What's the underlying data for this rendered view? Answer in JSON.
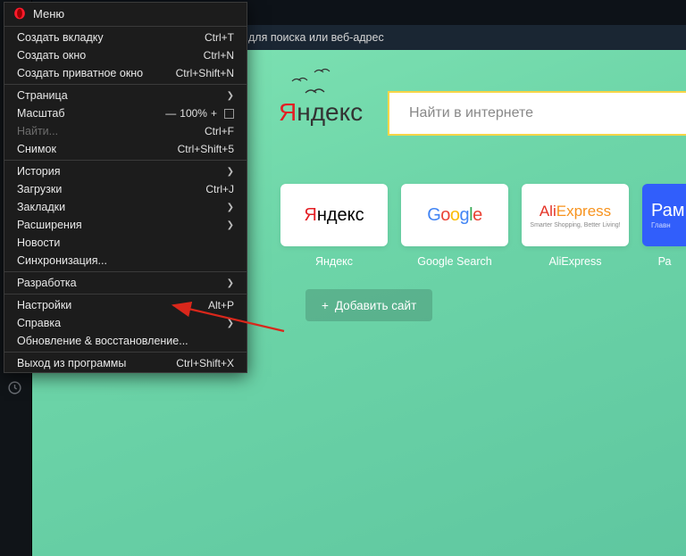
{
  "menu": {
    "header": "Меню",
    "items": [
      {
        "label": "Создать вкладку",
        "shortcut": "Ctrl+T"
      },
      {
        "label": "Создать окно",
        "shortcut": "Ctrl+N"
      },
      {
        "label": "Создать приватное окно",
        "shortcut": "Ctrl+Shift+N"
      }
    ],
    "group2": [
      {
        "label": "Страница",
        "submenu": true
      },
      {
        "label": "Масштаб",
        "zoom": true,
        "zoom_value": "100%"
      },
      {
        "label": "Найти...",
        "shortcut": "Ctrl+F",
        "disabled": true
      },
      {
        "label": "Снимок",
        "shortcut": "Ctrl+Shift+5"
      }
    ],
    "group3": [
      {
        "label": "История",
        "submenu": true
      },
      {
        "label": "Загрузки",
        "shortcut": "Ctrl+J"
      },
      {
        "label": "Закладки",
        "submenu": true
      },
      {
        "label": "Расширения",
        "submenu": true
      },
      {
        "label": "Новости"
      },
      {
        "label": "Синхронизация..."
      }
    ],
    "group4": [
      {
        "label": "Разработка",
        "submenu": true
      }
    ],
    "group5": [
      {
        "label": "Настройки",
        "shortcut": "Alt+P"
      },
      {
        "label": "Справка",
        "submenu": true
      },
      {
        "label": "Обновление & восстановление..."
      }
    ],
    "group6": [
      {
        "label": "Выход из программы",
        "shortcut": "Ctrl+Shift+X"
      }
    ]
  },
  "addressbar": {
    "placeholder": "для поиска или веб-адрес"
  },
  "logo": {
    "text": "Яндекс"
  },
  "search": {
    "placeholder": "Найти в интернете"
  },
  "tiles": [
    {
      "name": "yandex",
      "label": "Яндекс",
      "display": "Яндекс"
    },
    {
      "name": "google",
      "label": "Google Search",
      "display": "Google"
    },
    {
      "name": "aliexpress",
      "label": "AliExpress",
      "display": "AliExpress",
      "tagline": "Smarter Shopping, Better Living!"
    },
    {
      "name": "rambler",
      "label": "Ра",
      "display": "Рам",
      "tagline": "Главн"
    }
  ],
  "add_site": {
    "label": "Добавить сайт",
    "plus": "+"
  }
}
